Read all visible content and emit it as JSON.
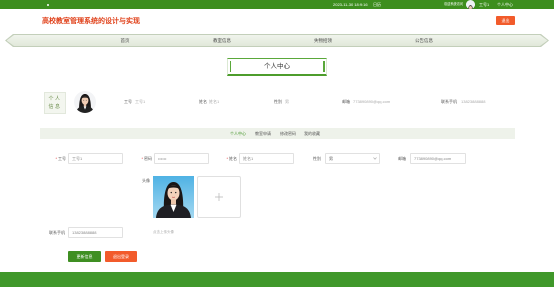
{
  "topbar": {
    "datetime": "2023-11-30 18:9:16",
    "calendar": "日历",
    "welcome": "欢迎系统访问",
    "username": "工号1",
    "profile_link": "个人中心"
  },
  "header": {
    "title": "高校教室管理系统的设计与实现",
    "logout_label": "退出"
  },
  "nav": {
    "items": [
      {
        "label": "首页"
      },
      {
        "label": "教室信息"
      },
      {
        "label": "失物招领"
      },
      {
        "label": "公告信息"
      }
    ]
  },
  "page_title": "个人中心",
  "profile_summary": {
    "badge_line1": "个人",
    "badge_line2": "信息",
    "fields": [
      {
        "label": "工号",
        "value": "工号1"
      },
      {
        "label": "姓名",
        "value": "姓名1"
      },
      {
        "label": "性别",
        "value": "男"
      },
      {
        "label": "邮箱",
        "value": "773890890@qq.com"
      },
      {
        "label": "联系手机",
        "value": "13823888888"
      }
    ]
  },
  "tabs": {
    "items": [
      {
        "label": "个人中心",
        "active": true
      },
      {
        "label": "教室申请",
        "active": false
      },
      {
        "label": "修改密码",
        "active": false
      },
      {
        "label": "我的收藏",
        "active": false
      }
    ]
  },
  "form": {
    "required_mark": "*",
    "fields": [
      {
        "label": "工号",
        "value": "工号1",
        "required": true
      },
      {
        "label": "密码",
        "value": "••••••",
        "required": true
      },
      {
        "label": "姓名",
        "value": "姓名1",
        "required": true
      },
      {
        "label": "性别",
        "value": "男",
        "required": false
      },
      {
        "label": "邮箱",
        "value": "773890890@qq.com",
        "required": false
      }
    ],
    "avatar_label": "头像",
    "avatar_hint": "点击上传头像",
    "phone_label": "联系手机",
    "phone_value": "13823888888"
  },
  "buttons": {
    "update": "更新信息",
    "logout": "退出登录"
  },
  "icons": {
    "select": "chevron-down-icon",
    "upload": "plus-icon",
    "topbar": "dot-icon"
  },
  "colors": {
    "primary_green": "#3d8e1e",
    "accent_red": "#f25b2b",
    "title_red": "#e0421b",
    "footer_green": "#40982a"
  }
}
